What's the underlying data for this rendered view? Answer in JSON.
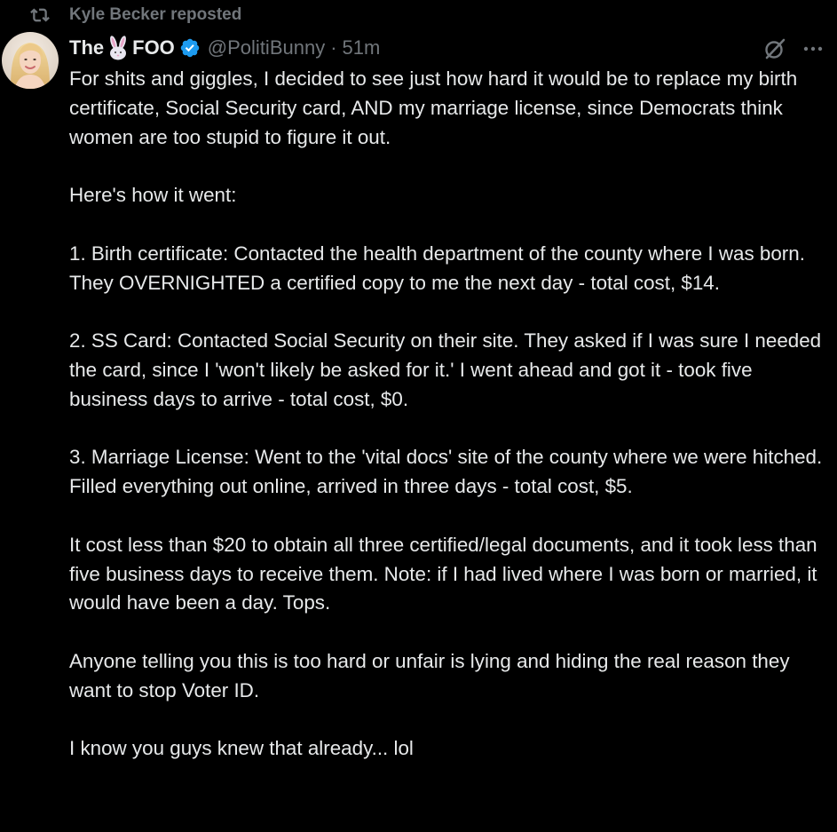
{
  "repost": {
    "icon": "repost-icon",
    "text": "Kyle Becker reposted"
  },
  "author": {
    "name_prefix": "The",
    "name_emoji": "rabbit-face-icon",
    "name_suffix": "FOO",
    "verified_icon": "verified-badge-icon",
    "handle": "@PolitiBunny",
    "separator": "·",
    "time": "51m",
    "avatar_icon": "avatar"
  },
  "actions": {
    "grok_icon": "grok-icon",
    "more_icon": "more-icon"
  },
  "colors": {
    "background": "#000000",
    "text": "#e7e9ea",
    "muted": "#71767b",
    "verified": "#1d9bf0"
  },
  "tweet": {
    "paragraphs": [
      "For shits and giggles, I decided to see just how hard it would be to replace my birth certificate, Social Security card, AND my marriage license, since Democrats think women are too stupid to figure it out.",
      "Here's how it went:",
      "1. Birth certificate: Contacted the health department of the county where I was born. They OVERNIGHTED a certified copy to me the next day - total cost, $14.",
      "2. SS Card: Contacted Social Security on their site. They asked if I was sure I needed the card, since I 'won't likely be asked for it.' I went ahead and got it - took five business days to arrive - total cost, $0.",
      "3. Marriage License: Went to the 'vital docs' site of the county where we were hitched. Filled everything out online, arrived in three days - total cost, $5.",
      "It cost less than $20 to obtain all three certified/legal documents, and it took less than five business days to receive them. Note: if I had lived where I was born or married, it would have been a day. Tops.",
      "Anyone telling you this is too hard or unfair is lying and hiding the real reason they want to stop Voter ID.",
      "I know you guys knew that already... lol"
    ]
  }
}
